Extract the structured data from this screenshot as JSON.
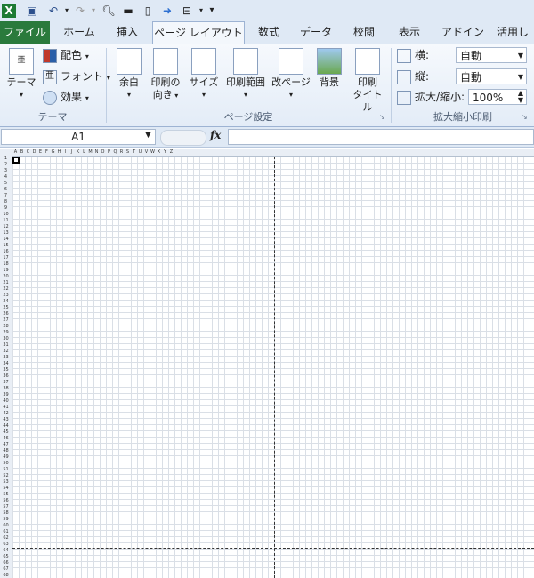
{
  "ribbon_tabs": [
    "ファイル",
    "ホーム",
    "挿入",
    "ページ レイアウト",
    "数式",
    "データ",
    "校閲",
    "表示",
    "アドイン",
    "活用し"
  ],
  "theme_group": {
    "big_label": "テーマ",
    "items": [
      "配色",
      "フォント",
      "効果"
    ],
    "group_label": "テーマ"
  },
  "page_setup_group": {
    "buttons": [
      {
        "line1": "余白",
        "line2": ""
      },
      {
        "line1": "印刷の",
        "line2": "向き"
      },
      {
        "line1": "サイズ",
        "line2": ""
      },
      {
        "line1": "印刷範囲",
        "line2": ""
      },
      {
        "line1": "改ページ",
        "line2": ""
      },
      {
        "line1": "背景",
        "line2": ""
      },
      {
        "line1": "印刷",
        "line2": "タイトル"
      }
    ],
    "group_label": "ページ設定"
  },
  "scale_group": {
    "width_label": "横:",
    "width_value": "自動",
    "height_label": "縦:",
    "height_value": "自動",
    "scale_label": "拡大/縮小:",
    "scale_value": "100%",
    "group_label": "拡大縮小印刷"
  },
  "formula_bar": {
    "name_box": "A1",
    "fx": "fx",
    "formula": ""
  },
  "grid": {
    "column_headers": [
      "A",
      "B",
      "C",
      "D",
      "E",
      "F",
      "G",
      "H",
      "I",
      "J",
      "K",
      "L",
      "M",
      "N",
      "O",
      "P",
      "Q",
      "R",
      "S",
      "T",
      "U",
      "V",
      "W",
      "X",
      "Y",
      "Z"
    ],
    "row_count": 68,
    "selected_cell": "A1"
  }
}
